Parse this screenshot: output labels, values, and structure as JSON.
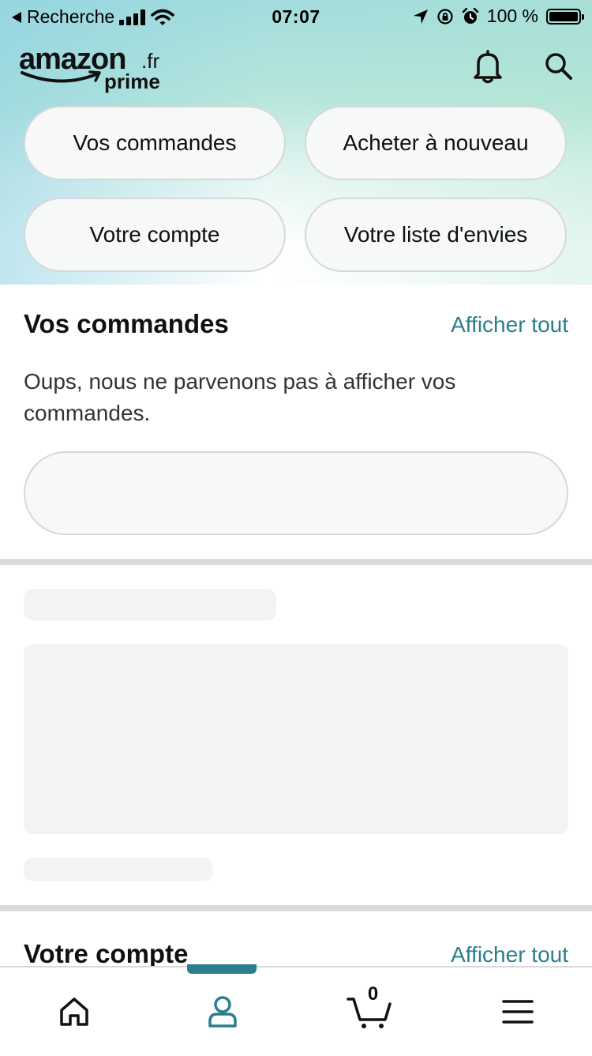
{
  "status_bar": {
    "back_label": "Recherche",
    "time": "07:07",
    "battery": "100 %"
  },
  "header": {
    "logo_word": "amazon",
    "logo_tld": ".fr",
    "logo_prime": "prime"
  },
  "quick_links": [
    {
      "label": "Vos commandes"
    },
    {
      "label": "Acheter à nouveau"
    },
    {
      "label": "Votre compte"
    },
    {
      "label": "Votre liste d'envies"
    }
  ],
  "orders": {
    "title": "Vos commandes",
    "see_all": "Afficher tout",
    "message": "Oups, nous ne parvenons pas à afficher vos commandes."
  },
  "account": {
    "title": "Votre compte",
    "see_all": "Afficher tout"
  },
  "tab_bar": {
    "cart_count": "0",
    "active_tab": "account",
    "accent_color": "#2a7f8b"
  }
}
